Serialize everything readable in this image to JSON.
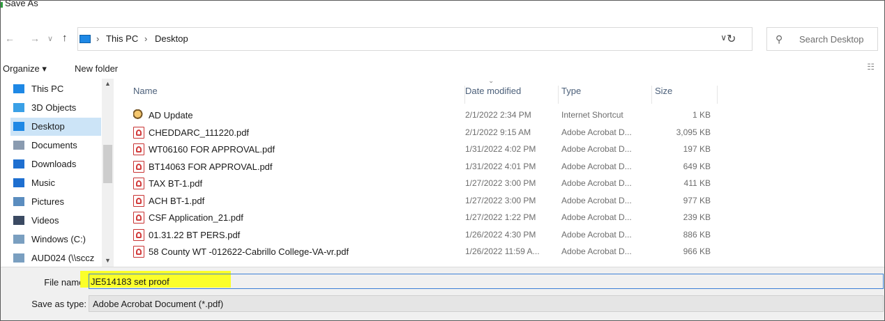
{
  "window": {
    "title": "Save As"
  },
  "nav": {
    "back": "←",
    "forward": "→",
    "recent": "∨",
    "up": "↑"
  },
  "address": {
    "crumbs": [
      "This PC",
      "Desktop"
    ],
    "separator": "›",
    "dropdown": "∨",
    "refresh": "↻"
  },
  "search": {
    "placeholder": "Search Desktop",
    "icon": "search-icon"
  },
  "toolbar": {
    "organize": "Organize ▾",
    "new_folder": "New folder",
    "view_icon": "☷"
  },
  "sidebar": {
    "items": [
      {
        "label": "This PC",
        "icon": "computer-icon",
        "color": "#1e88e5"
      },
      {
        "label": "3D Objects",
        "icon": "cube-icon",
        "color": "#3aa0e6"
      },
      {
        "label": "Desktop",
        "icon": "desktop-icon",
        "color": "#1e88e5",
        "selected": true
      },
      {
        "label": "Documents",
        "icon": "document-icon",
        "color": "#8a9bb0"
      },
      {
        "label": "Downloads",
        "icon": "download-icon",
        "color": "#1e6fd0"
      },
      {
        "label": "Music",
        "icon": "music-icon",
        "color": "#1e6fd0"
      },
      {
        "label": "Pictures",
        "icon": "pictures-icon",
        "color": "#5b8dbf"
      },
      {
        "label": "Videos",
        "icon": "video-icon",
        "color": "#3b4a62"
      },
      {
        "label": "Windows (C:)",
        "icon": "drive-icon",
        "color": "#7a9fc0"
      },
      {
        "label": "AUD024 (\\\\sccz",
        "icon": "network-drive-icon",
        "color": "#7a9fc0"
      }
    ]
  },
  "columns": {
    "name": "Name",
    "date": "Date modified",
    "type": "Type",
    "size": "Size"
  },
  "files": [
    {
      "name": "AD Update",
      "date": "2/1/2022 2:34 PM",
      "type": "Internet Shortcut",
      "size": "1 KB",
      "icon": "shortcut-icon"
    },
    {
      "name": "CHEDDARC_111220.pdf",
      "date": "2/1/2022 9:15 AM",
      "type": "Adobe Acrobat D...",
      "size": "3,095 KB",
      "icon": "pdf-icon"
    },
    {
      "name": "WT06160 FOR APPROVAL.pdf",
      "date": "1/31/2022 4:02 PM",
      "type": "Adobe Acrobat D...",
      "size": "197 KB",
      "icon": "pdf-icon"
    },
    {
      "name": "BT14063 FOR APPROVAL.pdf",
      "date": "1/31/2022 4:01 PM",
      "type": "Adobe Acrobat D...",
      "size": "649 KB",
      "icon": "pdf-icon"
    },
    {
      "name": "TAX BT-1.pdf",
      "date": "1/27/2022 3:00 PM",
      "type": "Adobe Acrobat D...",
      "size": "411 KB",
      "icon": "pdf-icon"
    },
    {
      "name": "ACH BT-1.pdf",
      "date": "1/27/2022 3:00 PM",
      "type": "Adobe Acrobat D...",
      "size": "977 KB",
      "icon": "pdf-icon"
    },
    {
      "name": "CSF Application_21.pdf",
      "date": "1/27/2022 1:22 PM",
      "type": "Adobe Acrobat D...",
      "size": "239 KB",
      "icon": "pdf-icon"
    },
    {
      "name": "01.31.22 BT  PERS.pdf",
      "date": "1/26/2022 4:30 PM",
      "type": "Adobe Acrobat D...",
      "size": "886 KB",
      "icon": "pdf-icon"
    },
    {
      "name": "58 County WT -012622-Cabrillo College-VA-vr.pdf",
      "date": "1/26/2022 11:59 A...",
      "type": "Adobe Acrobat D...",
      "size": "966 KB",
      "icon": "pdf-icon"
    }
  ],
  "footer": {
    "file_name_label": "File name:",
    "file_name_value": "JE514183 set proof",
    "save_type_label": "Save as type:",
    "save_type_value": "Adobe Acrobat Document (*.pdf)",
    "highlight_color": "#fbff2a"
  }
}
